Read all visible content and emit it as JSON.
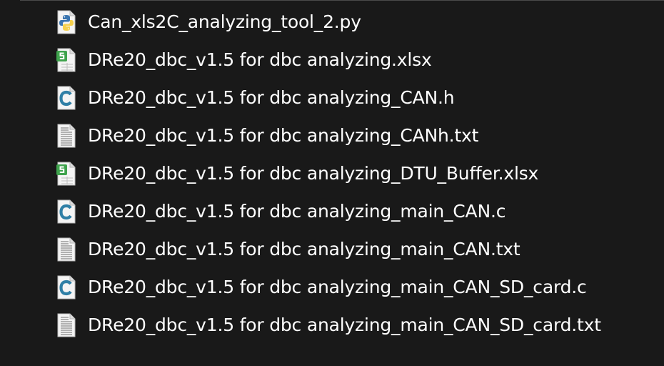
{
  "files": [
    {
      "name": "Can_xls2C_analyzing_tool_2.py",
      "icon": "python-file-icon"
    },
    {
      "name": "DRe20_dbc_v1.5 for dbc analyzing.xlsx",
      "icon": "spreadsheet-file-icon"
    },
    {
      "name": "DRe20_dbc_v1.5 for dbc analyzing_CAN.h",
      "icon": "c-source-file-icon"
    },
    {
      "name": "DRe20_dbc_v1.5 for dbc analyzing_CANh.txt",
      "icon": "text-file-icon"
    },
    {
      "name": "DRe20_dbc_v1.5 for dbc analyzing_DTU_Buffer.xlsx",
      "icon": "spreadsheet-file-icon"
    },
    {
      "name": "DRe20_dbc_v1.5 for dbc analyzing_main_CAN.c",
      "icon": "c-source-file-icon"
    },
    {
      "name": "DRe20_dbc_v1.5 for dbc analyzing_main_CAN.txt",
      "icon": "text-file-icon"
    },
    {
      "name": "DRe20_dbc_v1.5 for dbc analyzing_main_CAN_SD_card.c",
      "icon": "c-source-file-icon"
    },
    {
      "name": "DRe20_dbc_v1.5 for dbc analyzing_main_CAN_SD_card.txt",
      "icon": "text-file-icon"
    }
  ],
  "colors": {
    "background": "#191919",
    "text": "#ffffff",
    "python_blue": "#3a75b0",
    "python_yellow": "#f5d04c",
    "sheet_green": "#3fa34d",
    "c_blue": "#2f7fa6"
  }
}
